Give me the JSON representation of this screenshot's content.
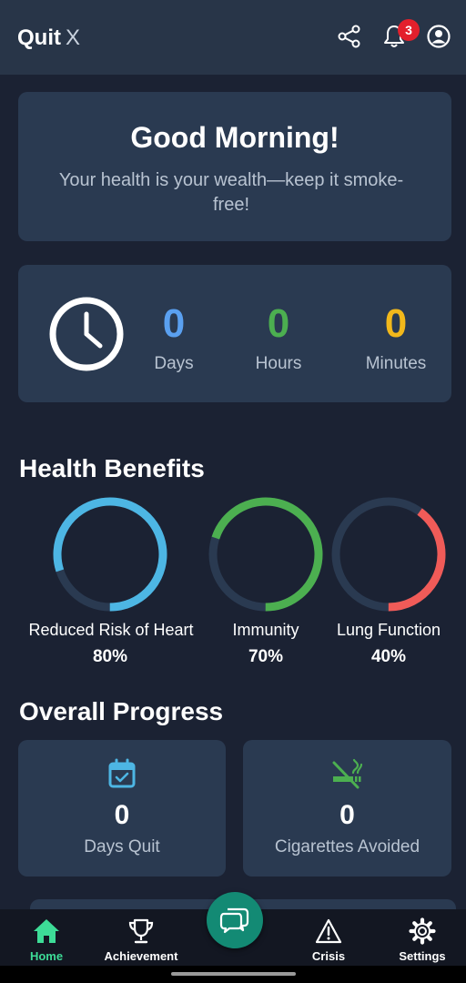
{
  "header": {
    "title": "Quit",
    "title_suffix": "X",
    "notification_count": "3",
    "icons": [
      "share-icon",
      "bell-icon",
      "account-icon"
    ]
  },
  "greeting": {
    "title": "Good Morning!",
    "subtitle": "Your health is your wealth—keep it smoke-free!"
  },
  "timer": {
    "icon": "clock-icon",
    "units": [
      {
        "value": "0",
        "label": "Days",
        "color": "#5aa0f0"
      },
      {
        "value": "0",
        "label": "Hours",
        "color": "#4caf50"
      },
      {
        "value": "0",
        "label": "Minutes",
        "color": "#f2b81b"
      }
    ]
  },
  "health_benefits": {
    "title": "Health Benefits",
    "items": [
      {
        "label": "Reduced Risk of Heart",
        "percent_text": "80%",
        "percent": 80,
        "color": "#4db6e4"
      },
      {
        "label": "Immunity",
        "percent_text": "70%",
        "percent": 70,
        "color": "#4caf50"
      },
      {
        "label": "Lung Function",
        "percent_text": "40%",
        "percent": 40,
        "color": "#f05b58"
      }
    ],
    "track_color": "#2a3a51"
  },
  "overall_progress": {
    "title": "Overall Progress",
    "cards": [
      {
        "value": "0",
        "label": "Days Quit",
        "icon": "calendar-check-icon",
        "color": "#4db6e4"
      },
      {
        "value": "0",
        "label": "Cigarettes Avoided",
        "icon": "no-smoking-icon",
        "color": "#4caf50"
      }
    ]
  },
  "bottom_nav": {
    "items": [
      {
        "label": "Home",
        "icon": "home-icon",
        "active": true
      },
      {
        "label": "Achievement",
        "icon": "trophy-icon",
        "active": false
      },
      {
        "label": "Crisis",
        "icon": "warning-icon",
        "active": false
      },
      {
        "label": "Settings",
        "icon": "gear-icon",
        "active": false
      }
    ],
    "fab_icon": "chat-icon",
    "active_color": "#3ddc97"
  }
}
